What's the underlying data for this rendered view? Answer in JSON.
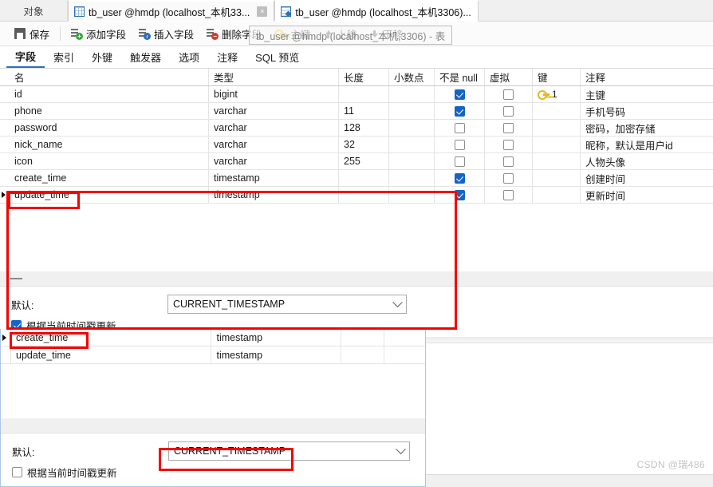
{
  "window_tabs": {
    "object_label": "对象",
    "tabs": [
      {
        "title": "tb_user @hmdp (localhost_本机33...",
        "icon": "table-grid-icon",
        "active": false,
        "closable": true,
        "close_label": "×"
      },
      {
        "title": "tb_user @hmdp (localhost_本机3306)...",
        "icon": "table-design-icon",
        "active": true,
        "closable": false,
        "close_label": ""
      }
    ]
  },
  "toolbar": {
    "save": "保存",
    "add_field": "添加字段",
    "insert_field": "插入字段",
    "delete_field": "删除字段",
    "primary_key": "主键",
    "move_up": "上移",
    "move_down": "下移",
    "tooltip": "tb_user @hmdp (localhost_本机,3306) - 表"
  },
  "subtabs": [
    {
      "label": "字段",
      "active": true
    },
    {
      "label": "索引",
      "active": false
    },
    {
      "label": "外键",
      "active": false
    },
    {
      "label": "触发器",
      "active": false
    },
    {
      "label": "选项",
      "active": false
    },
    {
      "label": "注释",
      "active": false
    },
    {
      "label": "SQL 预览",
      "active": false
    }
  ],
  "grid": {
    "headers": {
      "name": "名",
      "type": "类型",
      "length": "长度",
      "decimals": "小数点",
      "not_null": "不是 null",
      "virtual": "虚拟",
      "key": "键",
      "comment": "注释"
    },
    "rows": [
      {
        "selected": false,
        "name": "id",
        "type": "bigint",
        "length": "",
        "decimals": "",
        "not_null": true,
        "virtual": false,
        "key": "1",
        "comment": "主键"
      },
      {
        "selected": false,
        "name": "phone",
        "type": "varchar",
        "length": "11",
        "decimals": "",
        "not_null": true,
        "virtual": false,
        "key": "",
        "comment": "手机号码"
      },
      {
        "selected": false,
        "name": "password",
        "type": "varchar",
        "length": "128",
        "decimals": "",
        "not_null": false,
        "virtual": false,
        "key": "",
        "comment": "密码，加密存储"
      },
      {
        "selected": false,
        "name": "nick_name",
        "type": "varchar",
        "length": "32",
        "decimals": "",
        "not_null": false,
        "virtual": false,
        "key": "",
        "comment": "昵称，默认是用户id"
      },
      {
        "selected": false,
        "name": "icon",
        "type": "varchar",
        "length": "255",
        "decimals": "",
        "not_null": false,
        "virtual": false,
        "key": "",
        "comment": "人物头像"
      },
      {
        "selected": false,
        "name": "create_time",
        "type": "timestamp",
        "length": "",
        "decimals": "",
        "not_null": true,
        "virtual": false,
        "key": "",
        "comment": "创建时间"
      },
      {
        "selected": true,
        "name": "update_time",
        "type": "timestamp",
        "length": "",
        "decimals": "",
        "not_null": true,
        "virtual": false,
        "key": "",
        "comment": "更新时间"
      }
    ]
  },
  "detail_panel": {
    "default_label": "默认:",
    "default_value": "CURRENT_TIMESTAMP",
    "on_update_label": "根据当前时间戳更新",
    "on_update_checked": true
  },
  "overlay_window": {
    "rows": [
      {
        "selected": true,
        "name": "create_time",
        "type": "timestamp",
        "length": "",
        "decimals": ""
      },
      {
        "selected": false,
        "name": "update_time",
        "type": "timestamp",
        "length": "",
        "decimals": ""
      }
    ],
    "detail_panel": {
      "default_label": "默认:",
      "default_value": "CURRENT_TIMESTAMP",
      "on_update_label": "根据当前时间戳更新",
      "on_update_checked": false
    }
  },
  "annotations": {
    "color": "#f60000",
    "boxes": [
      {
        "name": "update-time-field-highlight"
      },
      {
        "name": "update-time-detail-highlight"
      },
      {
        "name": "create-time-field-highlight"
      },
      {
        "name": "create-time-default-highlight"
      }
    ]
  },
  "watermark": "CSDN @瑞486"
}
